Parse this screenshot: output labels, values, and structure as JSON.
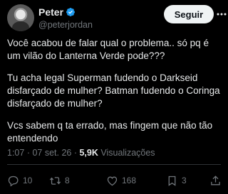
{
  "author": {
    "display_name": "Peter",
    "handle": "@peterjordan",
    "verified": true
  },
  "header": {
    "follow_label": "Seguir"
  },
  "tweet": {
    "paragraphs": [
      "Você acabou de falar qual o problema.. só pq é um vilão do Lanterna Verde pode???",
      "Tu acha legal Superman fudendo o Darkseid disfarçado de mulher? Batman fudendo o Coringa disfarçado de mulher?",
      "Vcs sabem q ta errado, mas fingem que não tão entendendo"
    ]
  },
  "meta": {
    "time": "1:07",
    "separator1": " · ",
    "date": "07 set. 26",
    "separator2": " · ",
    "views_count": "5,9K",
    "views_label": " Visualizações"
  },
  "actions": {
    "replies": "10",
    "retweets": "8",
    "likes": "168",
    "bookmarks": "3"
  },
  "colors": {
    "background": "#000000",
    "text": "#e7e9ea",
    "secondary": "#71767b",
    "verified": "#1d9bf0",
    "button_bg": "#eff3f4"
  },
  "icons": [
    "verified-badge-icon",
    "more-options-icon",
    "reply-icon",
    "retweet-icon",
    "like-icon",
    "bookmark-icon",
    "share-icon"
  ]
}
